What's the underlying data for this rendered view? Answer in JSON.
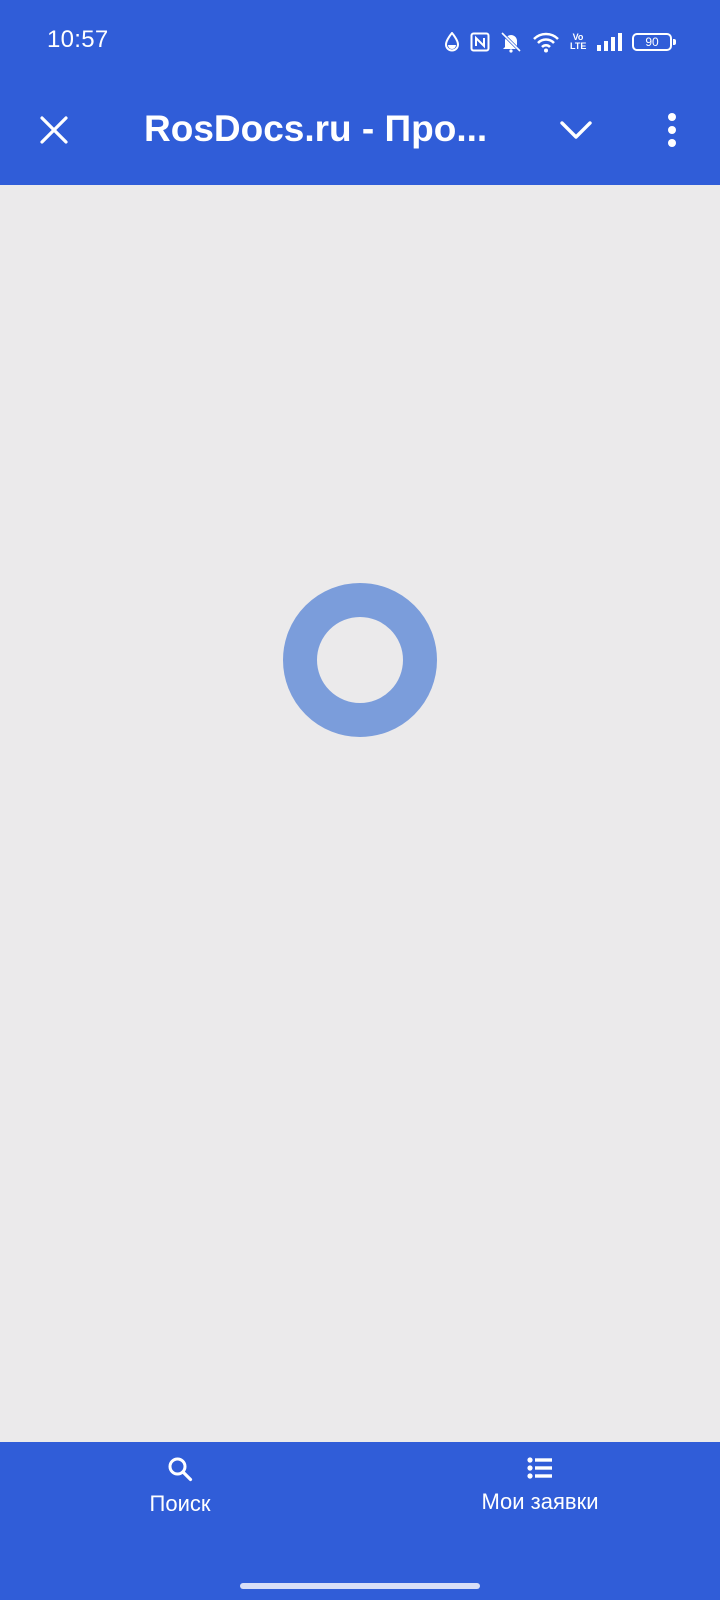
{
  "status_bar": {
    "time": "10:57",
    "battery": "90",
    "network": "Vo LTE",
    "icons": [
      "water-drop-icon",
      "nfc-icon",
      "muted-bell-icon",
      "wifi-icon",
      "volte-icon",
      "signal-icon",
      "battery-icon"
    ]
  },
  "app_bar": {
    "title": "RosDocs.ru - Про...",
    "close_icon": "close-icon",
    "expand_icon": "chevron-down-icon",
    "menu_icon": "more-vert-icon"
  },
  "content": {
    "state": "loading",
    "spinner_color": "#7b9ddb"
  },
  "bottom_nav": {
    "items": [
      {
        "label": "Поиск",
        "icon": "search-icon"
      },
      {
        "label": "Мои заявки",
        "icon": "list-icon"
      }
    ]
  },
  "colors": {
    "primary": "#305dd8",
    "background": "#ebeaeb",
    "on_primary": "#ffffff"
  }
}
